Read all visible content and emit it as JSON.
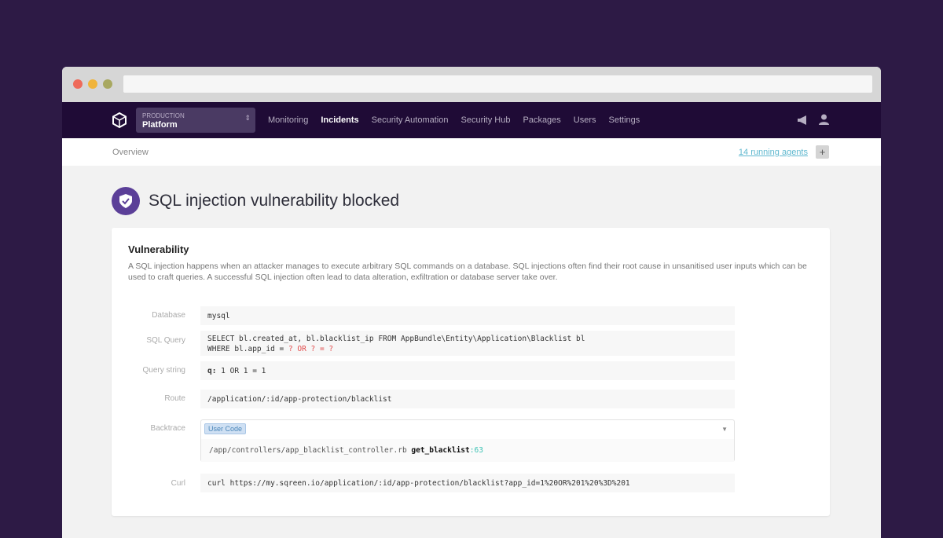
{
  "nav": {
    "env_label": "PRODUCTION",
    "env_value": "Platform",
    "links": [
      "Monitoring",
      "Incidents",
      "Security Automation",
      "Security Hub",
      "Packages",
      "Users",
      "Settings"
    ],
    "active": "Incidents"
  },
  "subbar": {
    "breadcrumb": "Overview",
    "agents_link": "14 running agents",
    "add": "+"
  },
  "page_title": "SQL injection vulnerability blocked",
  "card": {
    "heading": "Vulnerability",
    "description": "A SQL injection happens when an attacker manages to execute arbitrary SQL commands on a database. SQL injections often find their root cause in unsanitised user inputs which can be used to craft queries. A successful SQL injection often lead to data alteration, exfiltration or database server take over.",
    "fields": {
      "database_label": "Database",
      "database": "mysql",
      "sql_label": "SQL Query",
      "sql_line1": "SELECT bl.created_at, bl.blacklist_ip FROM AppBundle\\Entity\\Application\\Blacklist bl",
      "sql_line2": "WHERE bl.app_id = ",
      "sql_injected": "? OR ? = ?",
      "qs_label": "Query string",
      "qs_key": "q:",
      "qs_value": " 1 OR 1 = 1",
      "route_label": "Route",
      "route": "/application/:id/app-protection/blacklist",
      "bt_label": "Backtrace",
      "bt_tag": "User Code",
      "bt_file": "/app/controllers/app_blacklist_controller.rb ",
      "bt_func": "get_blacklist",
      "bt_line": ":63",
      "curl_label": "Curl",
      "curl": "curl https://my.sqreen.io/application/:id/app-protection/blacklist?app_id=1%20OR%201%20%3D%201"
    }
  }
}
